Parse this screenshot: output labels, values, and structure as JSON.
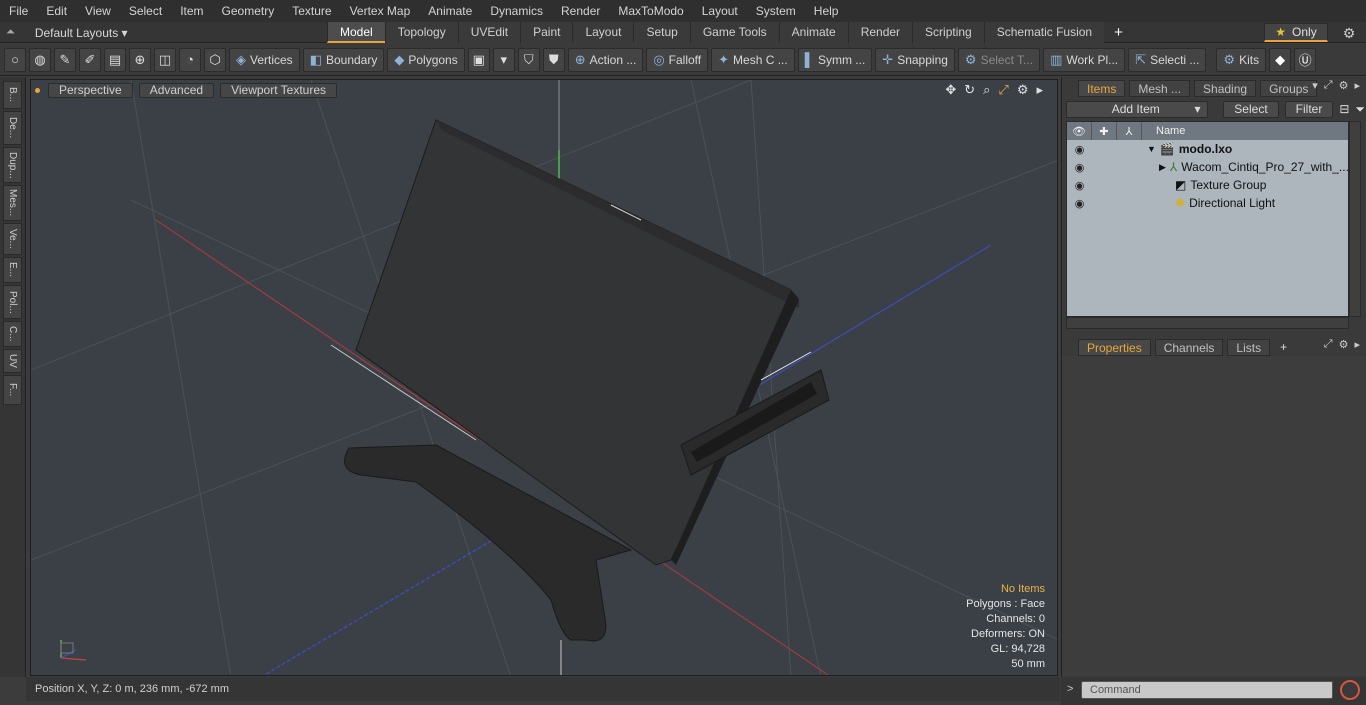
{
  "menu": [
    "File",
    "Edit",
    "View",
    "Select",
    "Item",
    "Geometry",
    "Texture",
    "Vertex Map",
    "Animate",
    "Dynamics",
    "Render",
    "MaxToModo",
    "Layout",
    "System",
    "Help"
  ],
  "layouts": {
    "label": "Default Layouts ▾"
  },
  "tabs": [
    "Model",
    "Topology",
    "UVEdit",
    "Paint",
    "Layout",
    "Setup",
    "Game Tools",
    "Animate",
    "Render",
    "Scripting",
    "Schematic Fusion"
  ],
  "tab_add": "+",
  "only": "Only",
  "toolbar": {
    "vertices": "Vertices",
    "boundary": "Boundary",
    "polygons": "Polygons",
    "action": "Action ...",
    "falloff": "Falloff",
    "mesh": "Mesh C ...",
    "symm": "Symm ...",
    "snapping": "Snapping",
    "select_t": "Select T...",
    "workpl": "Work Pl...",
    "selecti": "Selecti ...",
    "kits": "Kits"
  },
  "left_tabs": [
    "B...",
    "De...",
    "Dup...",
    "Mes...",
    "Ve...",
    "E...",
    "Pol...",
    "C...",
    "UV",
    "F..."
  ],
  "viewport": {
    "perspective": "Perspective",
    "advanced": "Advanced",
    "textures": "Viewport Textures",
    "info": {
      "no_items": "No Items",
      "polygons": "Polygons : Face",
      "channels": "Channels: 0",
      "deformers": "Deformers: ON",
      "gl": "GL: 94,728",
      "scale": "50 mm"
    }
  },
  "status": {
    "position": "Position X, Y, Z:   0 m, 236 mm, -672 mm"
  },
  "items_panel": {
    "tabs": [
      "Items",
      "Mesh ...",
      "Shading",
      "Groups"
    ],
    "add_item": "Add Item",
    "select": "Select",
    "filter": "Filter",
    "name_col": "Name",
    "tree": [
      "modo.lxo",
      "Wacom_Cintiq_Pro_27_with_...",
      "Texture Group",
      "Directional Light"
    ]
  },
  "props_panel": {
    "tabs": [
      "Properties",
      "Channels",
      "Lists"
    ],
    "add": "+"
  },
  "command": {
    "placeholder": "Command"
  },
  "colors": {
    "accent": "#e9a43a",
    "viewport_bg": "#3b4047",
    "tree_bg": "#adb5bd"
  }
}
